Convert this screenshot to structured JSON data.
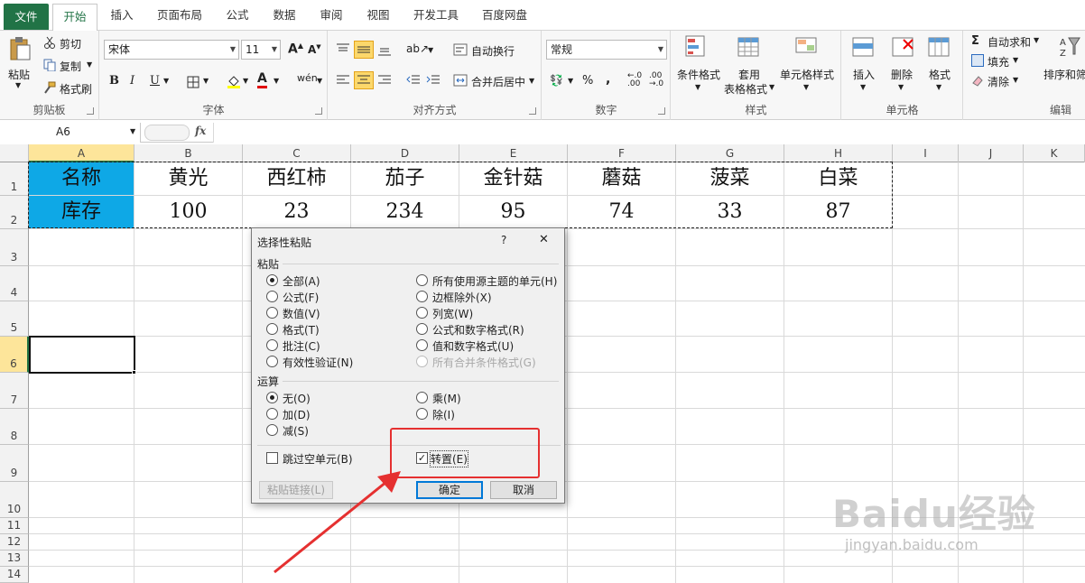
{
  "tabs": {
    "file": "文件",
    "home": "开始",
    "insert": "插入",
    "layout": "页面布局",
    "formula": "公式",
    "data": "数据",
    "review": "审阅",
    "view": "视图",
    "dev": "开发工具",
    "baidu": "百度网盘"
  },
  "ribbon": {
    "clipboard": {
      "paste": "粘贴",
      "cut": "剪切",
      "copy": "复制",
      "painter": "格式刷",
      "label": "剪贴板"
    },
    "font": {
      "name": "宋体",
      "size": "11",
      "label": "字体"
    },
    "align": {
      "wrap": "自动换行",
      "merge": "合并后居中",
      "label": "对齐方式"
    },
    "number": {
      "format": "常规",
      "label": "数字"
    },
    "styles": {
      "cond": "条件格式",
      "table1": "套用",
      "table2": "表格格式",
      "cellstyle": "单元格样式",
      "label": "样式"
    },
    "cells": {
      "insert": "插入",
      "delete": "删除",
      "format": "格式",
      "label": "单元格"
    },
    "edit": {
      "autosum": "自动求和",
      "fill": "填充",
      "clear": "清除",
      "sort": "排序和筛",
      "label": "编辑"
    }
  },
  "formula_bar": {
    "namebox": "A6",
    "fx": "fx"
  },
  "columns": [
    "A",
    "B",
    "C",
    "D",
    "E",
    "F",
    "G",
    "H",
    "I",
    "J",
    "K"
  ],
  "rows": [
    "1",
    "2",
    "3",
    "4",
    "5",
    "6",
    "7",
    "8",
    "9",
    "10",
    "11",
    "12",
    "13",
    "14"
  ],
  "sheet": {
    "row1": [
      "名称",
      "黄光",
      "西红柿",
      "茄子",
      "金针菇",
      "蘑菇",
      "菠菜",
      "白菜"
    ],
    "row2": [
      "库存",
      "100",
      "23",
      "234",
      "95",
      "74",
      "33",
      "87"
    ]
  },
  "dialog": {
    "title": "选择性粘贴",
    "help": "?",
    "close": "✕",
    "paste_section": "粘贴",
    "paste_left": [
      "全部(A)",
      "公式(F)",
      "数值(V)",
      "格式(T)",
      "批注(C)",
      "有效性验证(N)"
    ],
    "paste_right": [
      "所有使用源主题的单元(H)",
      "边框除外(X)",
      "列宽(W)",
      "公式和数字格式(R)",
      "值和数字格式(U)",
      "所有合并条件格式(G)"
    ],
    "op_section": "运算",
    "op_left": [
      "无(O)",
      "加(D)",
      "减(S)"
    ],
    "op_right": [
      "乘(M)",
      "除(I)"
    ],
    "skip_blanks": "跳过空单元(B)",
    "transpose": "转置(E)",
    "paste_link": "粘贴链接(L)",
    "ok": "确定",
    "cancel": "取消"
  },
  "watermark": {
    "brand": "Baidu经验",
    "url": "jingyan.baidu.com"
  },
  "colors": {
    "accent": "#217346",
    "highlight": "#e53030",
    "blue_cell": "#0ea8e6"
  }
}
